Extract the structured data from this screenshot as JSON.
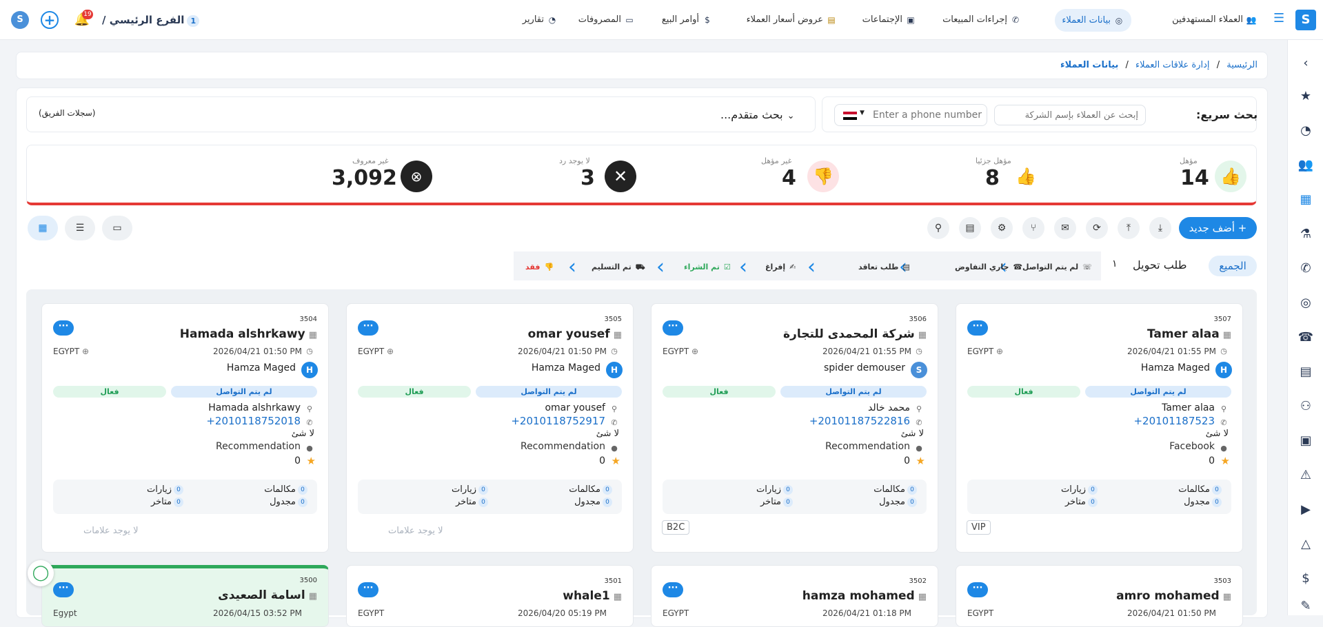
{
  "topbar": {
    "nav": [
      {
        "label": "العملاء المستهدفين",
        "icon": "target-customers-icon",
        "active": false
      },
      {
        "label": "بيانات العملاء",
        "icon": "customer-data-icon",
        "active": true
      },
      {
        "label": "إجراءات المبيعات",
        "icon": "phone-icon",
        "active": false
      },
      {
        "label": "الإجتماعات",
        "icon": "meeting-icon",
        "active": false
      },
      {
        "label": "عروض أسعار العملاء",
        "icon": "quote-icon",
        "active": false
      },
      {
        "label": "أوامر البيع",
        "icon": "money-bag-icon",
        "active": false
      },
      {
        "label": "المصروفات",
        "icon": "laptop-icon",
        "active": false
      },
      {
        "label": "تقارير",
        "icon": "reports-icon",
        "active": false
      }
    ],
    "branch_count": "1",
    "branch_name": "الفرع الرئيسي /",
    "notif_count": "19"
  },
  "breadcrumb": {
    "home": "الرئيسية",
    "sep": "/",
    "crm": "إدارة علاقات العملاء",
    "current": "بيانات العملاء"
  },
  "search": {
    "label": "بحث سريع:",
    "company_placeholder": "إبحث عن العملاء بإسم الشركة",
    "phone_placeholder": "Enter a phone number",
    "advanced": "بحث متقدم...",
    "team_records": "(سجلات الفريق)"
  },
  "kpis": [
    {
      "label": "مؤهل",
      "value": "14"
    },
    {
      "label": "مؤهل جزئيا",
      "value": "8"
    },
    {
      "label": "غير مؤهل",
      "value": "4"
    },
    {
      "label": "لا يوجد رد",
      "value": "3"
    },
    {
      "label": "غير معروف",
      "value": "3,092"
    }
  ],
  "toolbar": {
    "add_new": "+ أضف جديد"
  },
  "filters": {
    "all": "الجميع",
    "transfer": "طلب تحويل",
    "count": "١",
    "stages": [
      "لم يتم التواصل",
      "جاري التفاوض",
      "طلب تعاقد",
      "إفراغ",
      "تم الشراء",
      "تم التسليم",
      "فقد"
    ]
  },
  "cards": [
    {
      "id": "3507",
      "name": "Tamer alaa",
      "date": "2026/04/21 01:55 PM",
      "country": "EGYPT",
      "owner": "Hamza Maged",
      "owner_initial": "H",
      "stage": "لم يتم التواصل",
      "status": "فعال",
      "contact": "Tamer alaa",
      "phone": "+20101187523",
      "nothing": "لا شئ",
      "source": "Facebook",
      "rating": "0",
      "calls_label": "مكالمات",
      "calls": "0",
      "visits_label": "زيارات",
      "visits": "0",
      "scheduled_label": "مجدول",
      "scheduled": "0",
      "late_label": "متاخر",
      "late": "0",
      "tag": "VIP"
    },
    {
      "id": "3506",
      "name": "شركة المحمدى للتجارة",
      "date": "2026/04/21 01:55 PM",
      "country": "EGYPT",
      "owner": "spider demouser",
      "owner_initial": "",
      "stage": "لم يتم التواصل",
      "status": "فعال",
      "contact": "محمد خالد",
      "phone": "+20101187522816",
      "nothing": "لا شئ",
      "source": "Recommendation",
      "rating": "0",
      "calls_label": "مكالمات",
      "calls": "0",
      "visits_label": "زيارات",
      "visits": "0",
      "scheduled_label": "مجدول",
      "scheduled": "0",
      "late_label": "متاخر",
      "late": "0",
      "tag": "B2C"
    },
    {
      "id": "3505",
      "name": "omar yousef",
      "date": "2026/04/21 01:50 PM",
      "country": "EGYPT",
      "owner": "Hamza Maged",
      "owner_initial": "H",
      "stage": "لم يتم التواصل",
      "status": "فعال",
      "contact": "omar yousef",
      "phone": "+2010118752917",
      "nothing": "لا شئ",
      "source": "Recommendation",
      "rating": "0",
      "calls_label": "مكالمات",
      "calls": "0",
      "visits_label": "زيارات",
      "visits": "0",
      "scheduled_label": "مجدول",
      "scheduled": "0",
      "late_label": "متاخر",
      "late": "0",
      "notags": "لا يوجد علامات"
    },
    {
      "id": "3504",
      "name": "Hamada alshrkawy",
      "date": "2026/04/21 01:50 PM",
      "country": "EGYPT",
      "owner": "Hamza Maged",
      "owner_initial": "H",
      "stage": "لم يتم التواصل",
      "status": "فعال",
      "contact": "Hamada alshrkawy",
      "phone": "+2010118752018",
      "nothing": "لا شئ",
      "source": "Recommendation",
      "rating": "0",
      "calls_label": "مكالمات",
      "calls": "0",
      "visits_label": "زيارات",
      "visits": "0",
      "scheduled_label": "مجدول",
      "scheduled": "0",
      "late_label": "متاخر",
      "late": "0",
      "notags": "لا يوجد علامات"
    }
  ],
  "cards2": [
    {
      "id": "3503",
      "name": "amro mohamed",
      "date": "2026/04/21 01:50 PM",
      "country": "EGYPT"
    },
    {
      "id": "3502",
      "name": "hamza mohamed",
      "date": "2026/04/21 01:18 PM",
      "country": "EGYPT"
    },
    {
      "id": "3501",
      "name": "whale1",
      "date": "2026/04/20 05:19 PM",
      "country": "EGYPT"
    },
    {
      "id": "3500",
      "name": "اسامة الصعيدى",
      "date": "2026/04/15 03:52 PM",
      "country": "Egypt"
    }
  ],
  "colors": {
    "primary": "#1e88e5",
    "accent_red": "#e53935",
    "green": "#2ea85a",
    "kpi_red_bg": "#fde2e4"
  }
}
